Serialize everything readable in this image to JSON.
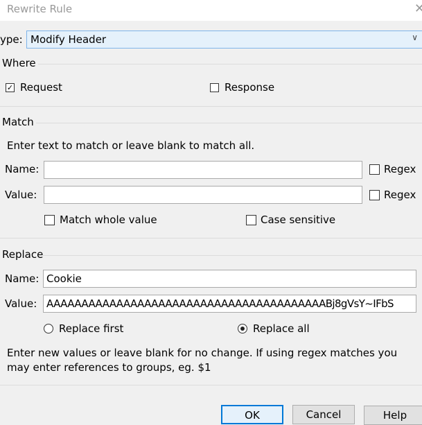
{
  "window": {
    "title": "Rewrite Rule",
    "close_icon": "close-icon"
  },
  "type": {
    "label": "ype:",
    "value": "Modify Header"
  },
  "where": {
    "heading": "Where",
    "request": {
      "label": "Request",
      "checked": true
    },
    "response": {
      "label": "Response",
      "checked": false
    }
  },
  "match": {
    "heading": "Match",
    "hint": "Enter text to match or leave blank to match all.",
    "name_label": "Name:",
    "name_value": "",
    "value_label": "Value:",
    "value_value": "",
    "regex_label": "Regex",
    "name_regex": false,
    "value_regex": false,
    "whole_label": "Match whole value",
    "case_label": "Case sensitive"
  },
  "replace": {
    "heading": "Replace",
    "name_label": "Name:",
    "name_value": "Cookie",
    "value_label": "Value:",
    "value_value": "AAAAAAAAAAAAAAAAAAAAAAAAAAAAAAAAAAAAAAAABj8gVsY~IFbS",
    "first_label": "Replace first",
    "all_label": "Replace all",
    "selected": "Replace all",
    "hint": "Enter new values or leave blank for no change. If using regex matches you may enter references to groups, eg. $1"
  },
  "buttons": {
    "ok": "OK",
    "cancel": "Cancel",
    "help": "Help"
  }
}
